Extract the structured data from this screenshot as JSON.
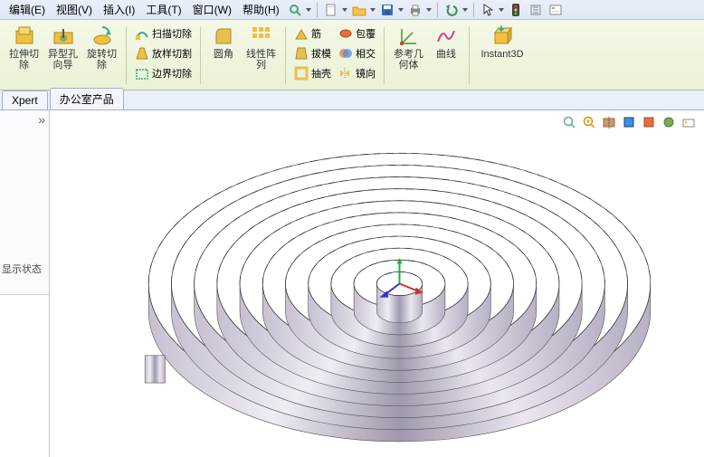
{
  "menubar": {
    "items": [
      {
        "label": "编辑(E)",
        "name": "menu-edit"
      },
      {
        "label": "视图(V)",
        "name": "menu-view"
      },
      {
        "label": "插入(I)",
        "name": "menu-insert"
      },
      {
        "label": "工具(T)",
        "name": "menu-tools"
      },
      {
        "label": "窗口(W)",
        "name": "menu-window"
      },
      {
        "label": "帮助(H)",
        "name": "menu-help"
      }
    ],
    "quick_icons": [
      {
        "name": "search-icon"
      },
      {
        "name": "new-doc-icon"
      },
      {
        "name": "open-icon"
      },
      {
        "name": "save-icon"
      },
      {
        "name": "print-icon"
      },
      {
        "name": "undo-icon"
      },
      {
        "name": "select-icon"
      },
      {
        "name": "traffic-icon"
      },
      {
        "name": "rebuild-icon"
      },
      {
        "name": "options-icon"
      }
    ]
  },
  "ribbon": {
    "buttons": [
      {
        "name": "extrude-cut-button",
        "label": "拉伸切\n除",
        "icon": "cube-yellow"
      },
      {
        "name": "hole-wizard-button",
        "label": "异型孔\n向导",
        "icon": "hole"
      },
      {
        "name": "revolve-cut-button",
        "label": "旋转切\n除",
        "icon": "revolve"
      }
    ],
    "col1": [
      {
        "name": "sweep-cut-button",
        "label": "扫描切除",
        "icon": "sweep"
      },
      {
        "name": "loft-cut-button",
        "label": "放样切割",
        "icon": "loft"
      },
      {
        "name": "boundary-cut-button",
        "label": "边界切除",
        "icon": "boundary"
      }
    ],
    "buttons2": [
      {
        "name": "fillet-button",
        "label": "圆角",
        "icon": "fillet"
      },
      {
        "name": "linear-pattern-button",
        "label": "线性阵\n列",
        "icon": "pattern"
      }
    ],
    "col2": [
      {
        "name": "rib-button",
        "label": "筋",
        "icon": "rib"
      },
      {
        "name": "draft-button",
        "label": "拔模",
        "icon": "draft"
      },
      {
        "name": "shell-button",
        "label": "抽壳",
        "icon": "shell"
      }
    ],
    "col3": [
      {
        "name": "wrap-button",
        "label": "包覆",
        "icon": "wrap"
      },
      {
        "name": "intersect-button",
        "label": "相交",
        "icon": "intersect"
      },
      {
        "name": "mirror-button",
        "label": "镜向",
        "icon": "mirror"
      }
    ],
    "buttons3": [
      {
        "name": "ref-geometry-button",
        "label": "参考几\n何体",
        "icon": "refgeo"
      },
      {
        "name": "curves-button",
        "label": "曲线",
        "icon": "curves"
      },
      {
        "name": "instant3d-button",
        "label": "Instant3D",
        "icon": "instant3d"
      }
    ]
  },
  "tabs": [
    {
      "name": "tab-xpert",
      "label": "Xpert"
    },
    {
      "name": "tab-office",
      "label": "办公室产品"
    }
  ],
  "side": {
    "collapse": "»",
    "status": "显示状态"
  },
  "view_icons": [
    {
      "name": "zoom-fit-icon"
    },
    {
      "name": "zoom-area-icon"
    },
    {
      "name": "section-icon"
    },
    {
      "name": "display-style-icon"
    },
    {
      "name": "hide-show-icon"
    },
    {
      "name": "appearance-icon"
    },
    {
      "name": "scene-icon"
    }
  ]
}
